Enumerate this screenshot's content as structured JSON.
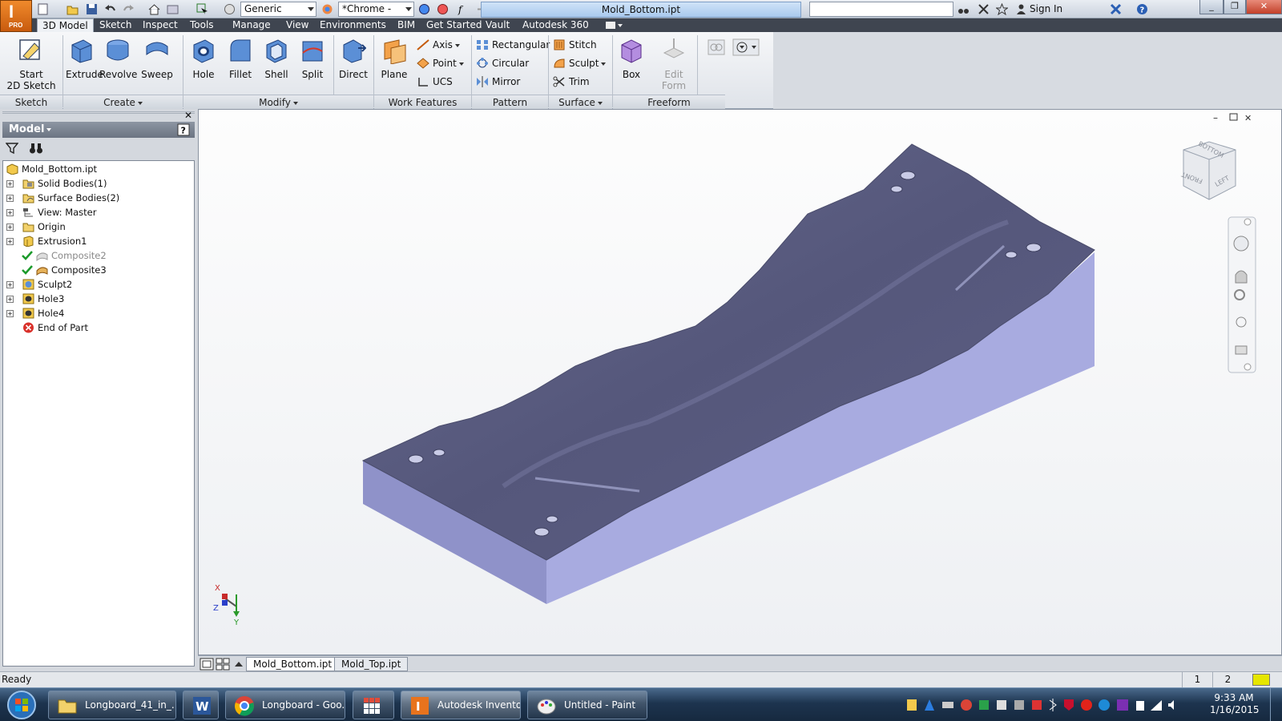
{
  "app": {
    "logo_letter": "I",
    "logo_badge": "PRO",
    "document_title": "Mold_Bottom.ipt",
    "material_combo": "Generic",
    "appearance_combo": "*Chrome -",
    "sign_in": "Sign In"
  },
  "tabs": [
    "3D Model",
    "Sketch",
    "Inspect",
    "Tools",
    "Manage",
    "View",
    "Environments",
    "BIM",
    "Get Started",
    "Vault",
    "Autodesk 360"
  ],
  "ribbon": {
    "sketch": {
      "start_line1": "Start",
      "start_line2": "2D Sketch",
      "label": "Sketch"
    },
    "create": {
      "extrude": "Extrude",
      "revolve": "Revolve",
      "sweep": "Sweep",
      "label": "Create"
    },
    "modify": {
      "hole": "Hole",
      "fillet": "Fillet",
      "shell": "Shell",
      "split": "Split",
      "direct": "Direct",
      "label": "Modify"
    },
    "work_features": {
      "plane": "Plane",
      "axis": "Axis",
      "point": "Point",
      "ucs": "UCS",
      "label": "Work Features"
    },
    "pattern": {
      "rectangular": "Rectangular",
      "circular": "Circular",
      "mirror": "Mirror",
      "label": "Pattern"
    },
    "surface": {
      "stitch": "Stitch",
      "sculpt": "Sculpt",
      "trim": "Trim",
      "label": "Surface"
    },
    "freeform": {
      "box": "Box",
      "edit_line1": "Edit",
      "edit_line2": "Form",
      "label": "Freeform"
    }
  },
  "browser": {
    "title": "Model",
    "tree": [
      {
        "label": "Mold_Bottom.ipt",
        "icon": "part-icon"
      },
      {
        "label": "Solid Bodies(1)",
        "icon": "folder-icon"
      },
      {
        "label": "Surface Bodies(2)",
        "icon": "folder-icon"
      },
      {
        "label": "View: Master",
        "icon": "view-icon"
      },
      {
        "label": "Origin",
        "icon": "folder-icon"
      },
      {
        "label": "Extrusion1",
        "icon": "extrude-icon"
      },
      {
        "label": "Composite2",
        "icon": "composite-icon"
      },
      {
        "label": "Composite3",
        "icon": "composite-icon"
      },
      {
        "label": "Sculpt2",
        "icon": "sculpt-icon"
      },
      {
        "label": "Hole3",
        "icon": "hole-icon"
      },
      {
        "label": "Hole4",
        "icon": "hole-icon"
      },
      {
        "label": "End of Part",
        "icon": "end-of-part-icon"
      }
    ]
  },
  "viewcube": {
    "top": "BOTTOM",
    "front": "FRONT",
    "left": "LEFT"
  },
  "triad": {
    "x": "X",
    "y": "Y",
    "z": "Z"
  },
  "document_tabs": [
    "Mold_Bottom.ipt",
    "Mold_Top.ipt"
  ],
  "status": {
    "text": "Ready",
    "page1": "1",
    "page2": "2"
  },
  "taskbar": {
    "items": [
      "Longboard_41_in_...",
      "Longboard - Goo...",
      "Autodesk Invento...",
      "Untitled - Paint"
    ],
    "time": "9:33 AM",
    "date": "1/16/2015"
  },
  "colors": {
    "accent": "#e8731d",
    "model_top": "#5f6184",
    "model_side": "#a8abe0",
    "model_front": "#8f92c9"
  }
}
